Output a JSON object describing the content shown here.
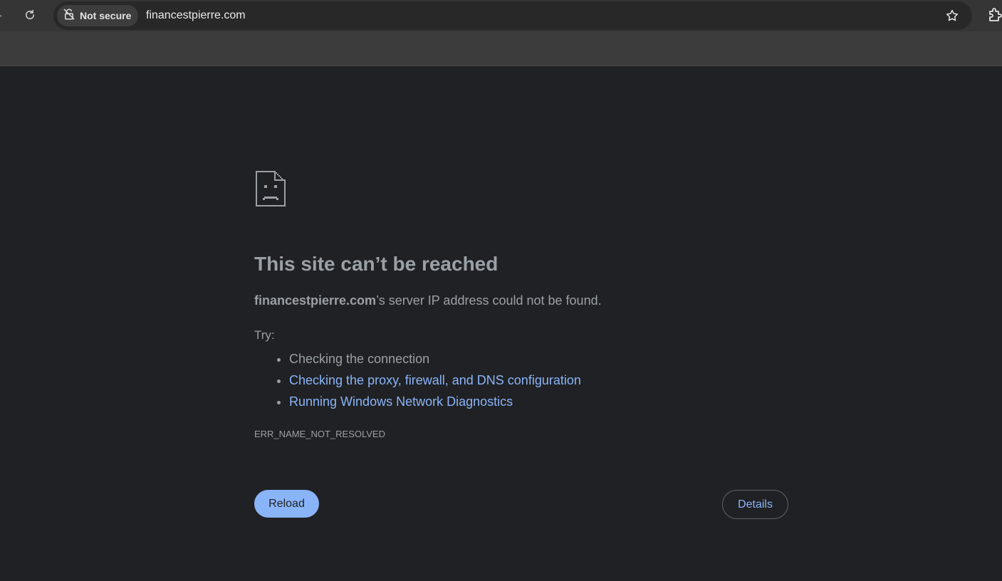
{
  "browser": {
    "security_label": "Not secure",
    "url": "financestpierre.com",
    "icons": [
      "reload-icon",
      "not-secure-icon",
      "bookmark-star-icon",
      "extensions-icon"
    ]
  },
  "error_page": {
    "icon": "sad-page-icon",
    "heading": "This site can’t be reached",
    "summary_host": "financestpierre.com",
    "summary_rest": "’s server IP address could not be found.",
    "try_label": "Try:",
    "suggestions": [
      {
        "label": "Checking the connection",
        "link": false
      },
      {
        "label": "Checking the proxy, firewall, and DNS configuration",
        "link": true
      },
      {
        "label": "Running Windows Network Diagnostics",
        "link": true
      }
    ],
    "error_code": "ERR_NAME_NOT_RESOLVED",
    "reload_label": "Reload",
    "details_label": "Details"
  },
  "colors": {
    "background": "#202124",
    "text": "#9aa0a6",
    "link": "#8ab4f8",
    "button": "#8ab4f8"
  }
}
